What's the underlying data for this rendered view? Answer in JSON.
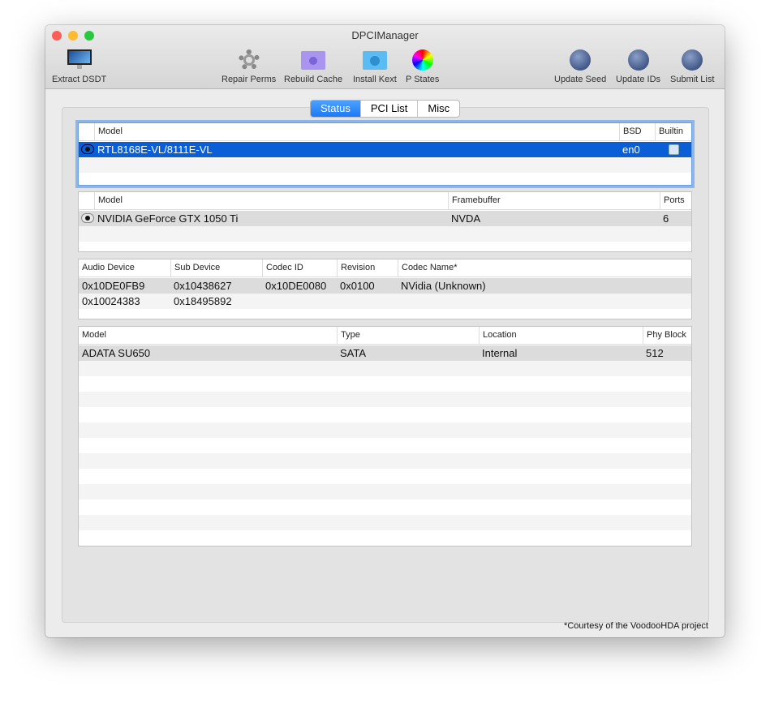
{
  "window": {
    "title": "DPCIManager"
  },
  "toolbar": [
    {
      "label": "Extract DSDT",
      "icon": "imac-icon"
    },
    {
      "label": "Repair Perms",
      "icon": "gear-icon"
    },
    {
      "label": "Rebuild Cache",
      "icon": "folder-gear-icon"
    },
    {
      "label": "Install Kext",
      "icon": "folder-radiation-icon"
    },
    {
      "label": "P States",
      "icon": "color-wheel-icon"
    },
    {
      "label": "Update Seed",
      "icon": "globe-icon"
    },
    {
      "label": "Update IDs",
      "icon": "globe-icon"
    },
    {
      "label": "Submit List",
      "icon": "globe-icon"
    }
  ],
  "tabs": [
    {
      "label": "Status",
      "active": true
    },
    {
      "label": "PCI List"
    },
    {
      "label": "Misc"
    }
  ],
  "network": {
    "headers": [
      "Model",
      "BSD",
      "Builtin"
    ],
    "rows": [
      [
        "RTL8168E-VL/8111E-VL",
        "en0",
        "✓"
      ]
    ]
  },
  "graphics": {
    "headers": [
      "Model",
      "Framebuffer",
      "Ports"
    ],
    "rows": [
      [
        "NVIDIA GeForce GTX 1050 Ti",
        "NVDA",
        "6"
      ]
    ]
  },
  "audio": {
    "headers": [
      "Audio Device",
      "Sub Device",
      "Codec ID",
      "Revision",
      "Codec Name*"
    ],
    "rows": [
      [
        "0x10DE0FB9",
        "0x10438627",
        "0x10DE0080",
        "0x0100",
        "NVidia (Unknown)"
      ],
      [
        "0x10024383",
        "0x18495892",
        "",
        "",
        ""
      ]
    ]
  },
  "storage": {
    "headers": [
      "Model",
      "Type",
      "Location",
      "Phy Block"
    ],
    "rows": [
      [
        "ADATA SU650",
        "SATA",
        "Internal",
        "512"
      ]
    ]
  },
  "footer": "*Courtesy of the VoodooHDA project"
}
